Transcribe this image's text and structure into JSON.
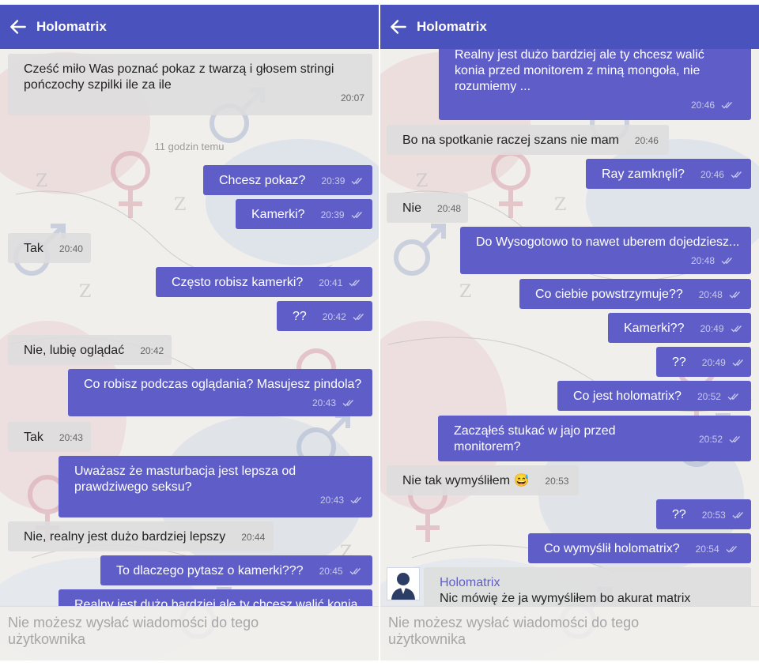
{
  "left_panel": {
    "title": "Holomatrix",
    "separator": "11 godzin temu",
    "messages": [
      {
        "dir": "in",
        "text": "Cześć miło Was poznać pokaz z twarzą i głosem stringi pończochy szpilki ile za ile",
        "time": "20:07"
      },
      {
        "dir": "out",
        "text": "Chcesz pokaz?",
        "time": "20:39"
      },
      {
        "dir": "out",
        "text": "Kamerki?",
        "time": "20:39"
      },
      {
        "dir": "in",
        "text": "Tak",
        "time": "20:40"
      },
      {
        "dir": "out",
        "text": "Często robisz kamerki?",
        "time": "20:41"
      },
      {
        "dir": "out",
        "text": "??",
        "time": "20:42"
      },
      {
        "dir": "in",
        "text": "Nie, lubię oglądać",
        "time": "20:42"
      },
      {
        "dir": "out",
        "text": "Co robisz podczas oglądania? Masujesz pindola?",
        "time": "20:43"
      },
      {
        "dir": "in",
        "text": "Tak",
        "time": "20:43"
      },
      {
        "dir": "out",
        "text": "Uważasz że masturbacja jest lepsza od prawdziwego seksu?",
        "time": "20:43"
      },
      {
        "dir": "in",
        "text": "Nie, realny jest dużo bardziej lepszy",
        "time": "20:44"
      },
      {
        "dir": "out",
        "text": "To dlaczego pytasz o kamerki???",
        "time": "20:45"
      },
      {
        "dir": "out",
        "text": "Realny jest dużo bardziej ale ty chcesz walić konia",
        "time": ""
      }
    ],
    "footer": "Nie możesz wysłać wiadomości do tego użytkownika"
  },
  "right_panel": {
    "title": "Holomatrix",
    "messages": [
      {
        "dir": "out",
        "text": "Realny jest dużo bardziej ale ty chcesz walić konia przed monitorem z miną mongoła, nie rozumiemy ...",
        "time": "20:46"
      },
      {
        "dir": "in",
        "text": "Bo na spotkanie raczej szans nie mam",
        "time": "20:46"
      },
      {
        "dir": "out",
        "text": "Ray zamknęli?",
        "time": "20:46"
      },
      {
        "dir": "in",
        "text": "Nie",
        "time": "20:48"
      },
      {
        "dir": "out",
        "text": "Do Wysogotowo to nawet uberem dojedziesz...",
        "time": "20:48"
      },
      {
        "dir": "out",
        "text": "Co ciebie powstrzymuje??",
        "time": "20:48"
      },
      {
        "dir": "out",
        "text": "Kamerki??",
        "time": "20:49"
      },
      {
        "dir": "out",
        "text": "??",
        "time": "20:49"
      },
      {
        "dir": "out",
        "text": "Co jest holomatrix?",
        "time": "20:52"
      },
      {
        "dir": "out",
        "text": "Zacząłeś stukać w jajo przed monitorem?",
        "time": "20:52"
      },
      {
        "dir": "in",
        "text": "Nie tak wymyśliłem 😅",
        "time": "20:53"
      },
      {
        "dir": "out",
        "text": "??",
        "time": "20:53"
      },
      {
        "dir": "out",
        "text": "Co wymyślił holomatrix?",
        "time": "20:54"
      },
      {
        "dir": "in",
        "sender": "Holomatrix",
        "text": "Nic mówię że ja wymyśliłem bo akurat matrix",
        "time": ""
      }
    ],
    "footer": "Nie możesz wysłać wiadomości do tego użytkownika"
  },
  "icons": {
    "back": "arrow-left-icon",
    "read": "double-check-icon",
    "avatar": "user-avatar-icon"
  },
  "colors": {
    "header": "#4a53bd",
    "outgoing": "#5f5ec9",
    "incoming": "#dddddd",
    "background": "#f1efec"
  }
}
